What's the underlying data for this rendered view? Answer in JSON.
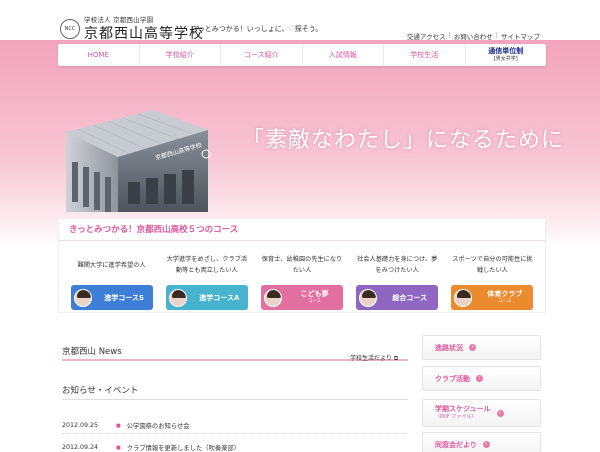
{
  "header": {
    "logo_badge": "NCC",
    "logo_sub": "学校法人 京都西山学園",
    "logo_main": "京都西山高等学校",
    "tagline_pre": "きっとみつかる！いっしょに、",
    "tagline_heart": "♡",
    "tagline_post": "探そう。",
    "util_links": [
      "交通アクセス",
      "お問い合わせ",
      "サイトマップ"
    ]
  },
  "nav": {
    "items": [
      "HOME",
      "学校紹介",
      "コース紹介",
      "入試情報",
      "学校生活"
    ],
    "special": {
      "label": "通信単位制",
      "sub": "[男女共学]"
    }
  },
  "hero": {
    "copy": "「素敵なわたし」になるために",
    "building_sign": "京都西山高等学校"
  },
  "courses": {
    "heading": "きっとみつかる！京都西山高校５つのコース",
    "items": [
      {
        "desc": "難関大学に進学希望の人",
        "label": "進学コースS",
        "sub": "",
        "color": "#3d7fd6"
      },
      {
        "desc": "大学進学をめざし、クラブ活動等とも両立したい人",
        "label": "進学コースA",
        "sub": "",
        "color": "#46b3cf"
      },
      {
        "desc": "保育士、幼稚園の先生になりたい人",
        "label": "こども夢",
        "sub": "コース",
        "color": "#e26fa0"
      },
      {
        "desc": "社会人基礎力を身につけ、夢をみつけたい人",
        "label": "総合コース",
        "sub": "",
        "color": "#8e67c2"
      },
      {
        "desc": "スポーツで自分の可能性に挑戦したい人",
        "label": "体育クラブ",
        "sub": "コース",
        "color": "#ec8a2e"
      }
    ]
  },
  "news": {
    "title": "京都西山 News",
    "more": "学校生活だより"
  },
  "events": {
    "title": "お知らせ・イベント",
    "items": [
      {
        "date": "2012.09.25",
        "text": "公学園祭のお知らせ会"
      },
      {
        "date": "2012.09.24",
        "text": "クラブ情報を更新しました（吹奏楽部）"
      }
    ]
  },
  "sidebar": {
    "items": [
      {
        "label": "進路状況",
        "sub": ""
      },
      {
        "label": "クラブ活動",
        "sub": ""
      },
      {
        "label": "学期スケジュール",
        "sub": "（PDF ファイル）"
      },
      {
        "label": "同窓会だより",
        "sub": ""
      }
    ]
  }
}
